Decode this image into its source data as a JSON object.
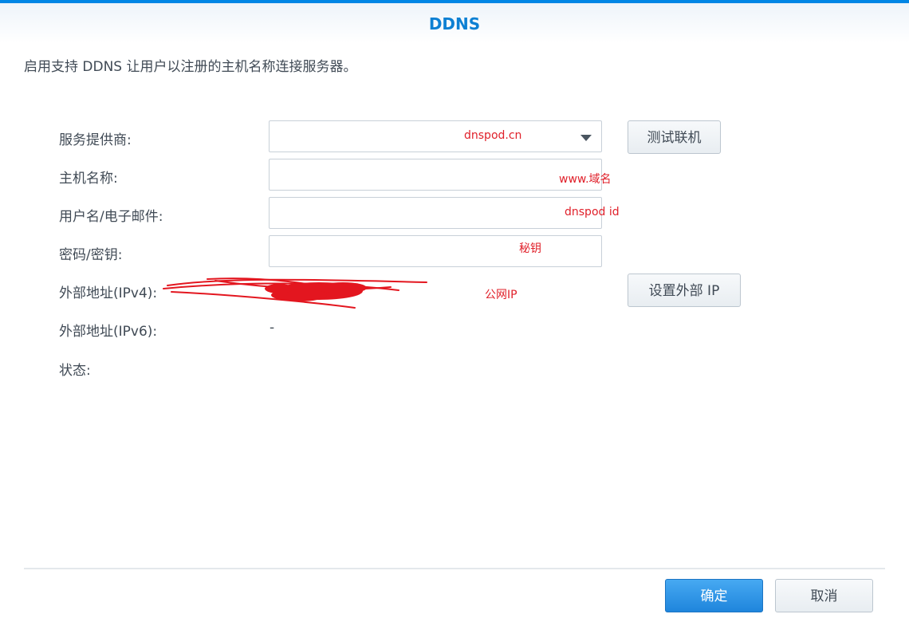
{
  "dialog": {
    "title": "DDNS",
    "description": "启用支持 DDNS 让用户以注册的主机名称连接服务器。"
  },
  "form": {
    "provider_label": "服务提供商:",
    "provider_value": "",
    "hostname_label": "主机名称:",
    "hostname_value": "",
    "username_label": "用户名/电子邮件:",
    "username_value": "",
    "password_label": "密码/密钥:",
    "password_value": "",
    "ipv4_label": "外部地址(IPv4):",
    "ipv6_label": "外部地址(IPv6):",
    "ipv6_value": "-",
    "status_label": "状态:",
    "status_value": ""
  },
  "buttons": {
    "test_connection": "测试联机",
    "set_external_ip": "设置外部 IP",
    "ok": "确定",
    "cancel": "取消"
  },
  "annotations": {
    "provider": "dnspod.cn",
    "hostname": "www.域名",
    "username": "dnspod id",
    "password": "秘钥",
    "ipv4": "公网IP"
  },
  "colors": {
    "accent": "#0086e5",
    "title": "#0d80d3",
    "annotation": "#e0202a",
    "scribble": "#e3161f"
  }
}
